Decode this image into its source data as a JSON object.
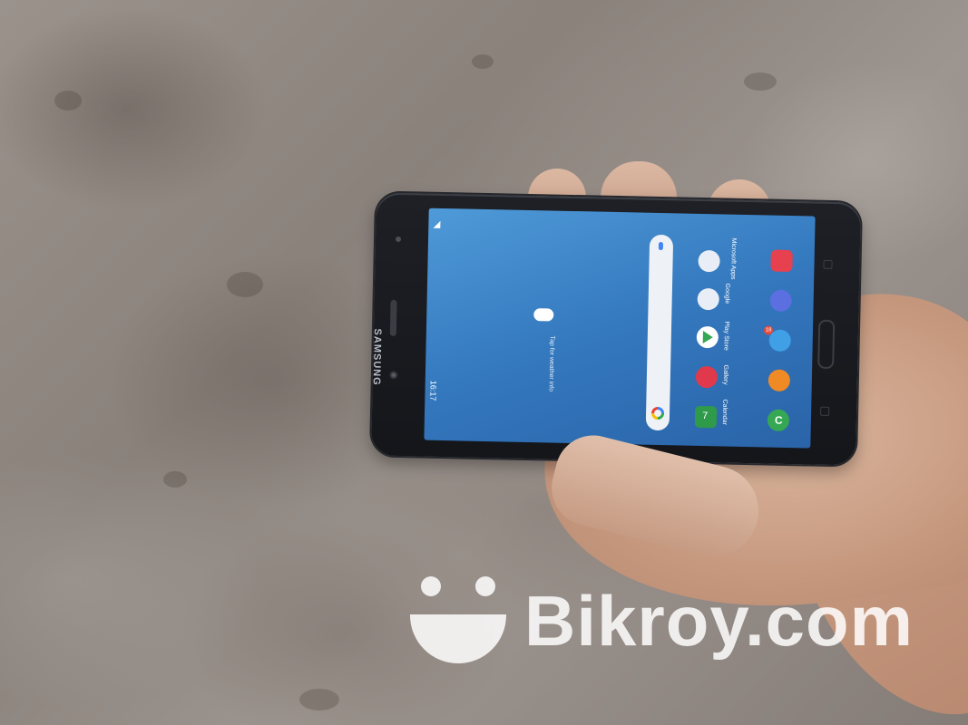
{
  "phone": {
    "brand": "SAMSUNG",
    "status_time": "16:17",
    "weather_prompt": "Tap for weather info",
    "apps": [
      {
        "name": "microsoft-apps-folder",
        "label": "Microsoft Apps",
        "color": "#e9eef6"
      },
      {
        "name": "google-folder",
        "label": "Google",
        "color": "#e9eef6"
      },
      {
        "name": "play-store",
        "label": "Play Store",
        "color": "#ffffff"
      },
      {
        "name": "gallery",
        "label": "Gallery",
        "color": "#e0394b"
      },
      {
        "name": "calendar",
        "label": "Calendar",
        "color": "#2e9a4a",
        "glyph": "7"
      },
      {
        "name": "camera",
        "label": "",
        "color": "#e7404e"
      },
      {
        "name": "internet",
        "label": "",
        "color": "#5b6fe0"
      },
      {
        "name": "messages",
        "label": "",
        "color": "#3fa0e6",
        "badge": "18"
      },
      {
        "name": "contacts",
        "label": "",
        "color": "#f08a24"
      },
      {
        "name": "phone",
        "label": "",
        "color": "#36a853",
        "glyph": "C"
      }
    ]
  },
  "watermark": {
    "text": "Bikroy.com"
  }
}
